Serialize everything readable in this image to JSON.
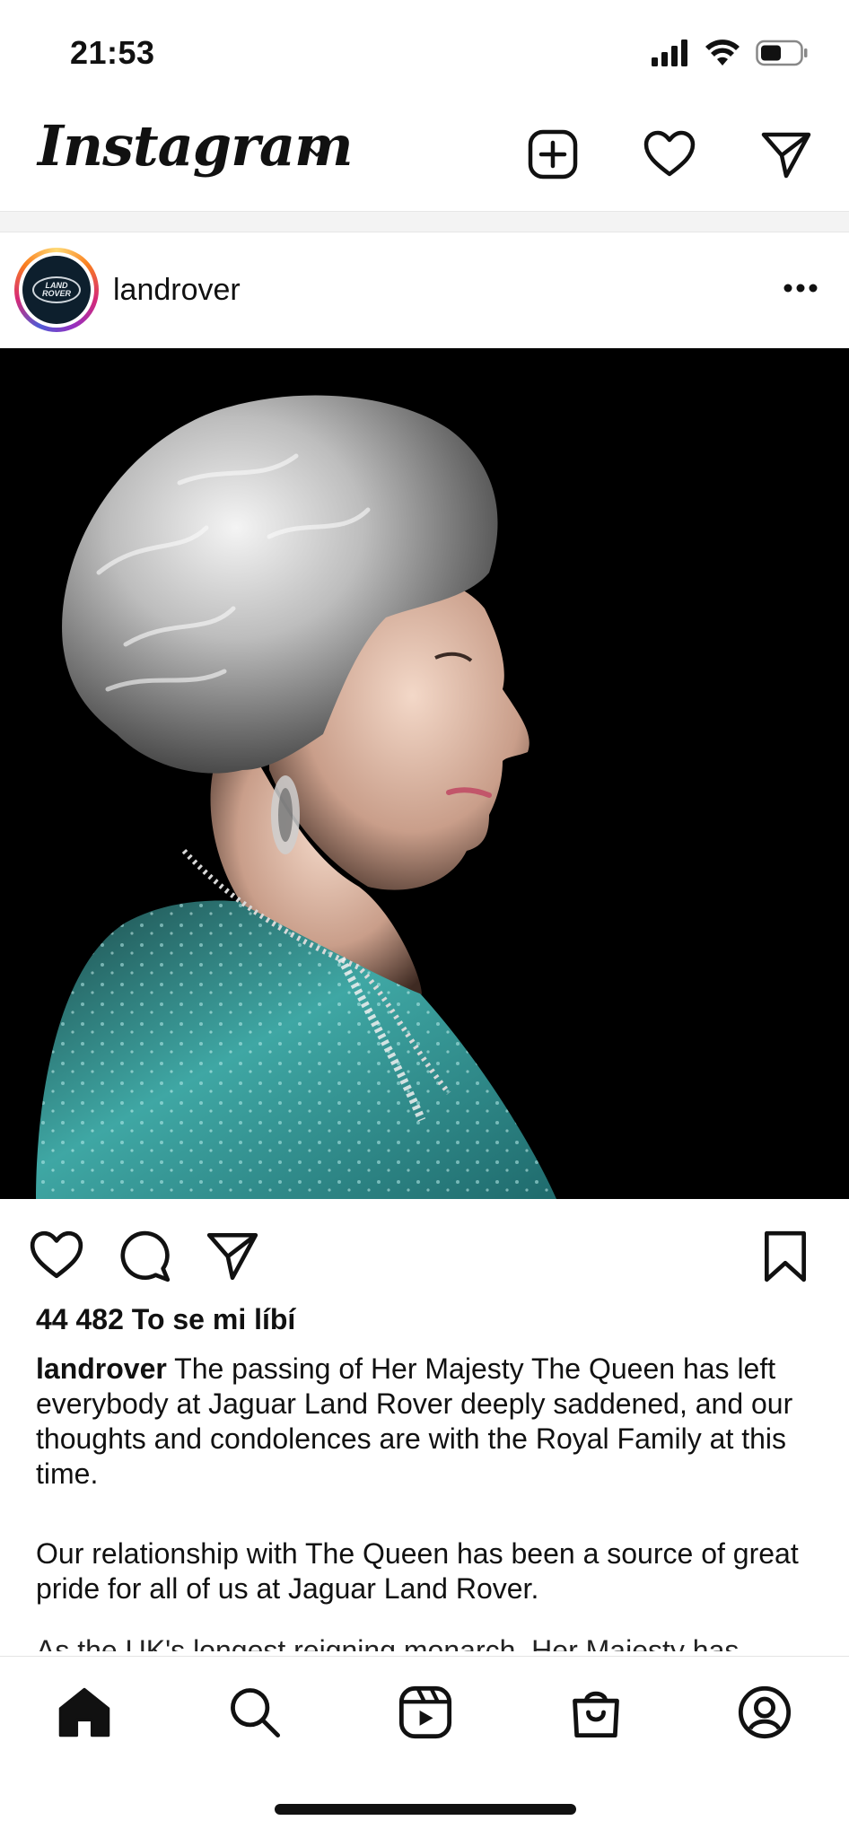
{
  "status_bar": {
    "time": "21:53",
    "icons": [
      "cellular-signal-icon",
      "wifi-icon",
      "battery-icon"
    ]
  },
  "header": {
    "logo": "Instagram",
    "icons": [
      "chevron-down-icon",
      "new-post-icon",
      "activity-heart-icon",
      "direct-messages-icon"
    ]
  },
  "post": {
    "username": "landrover",
    "avatar_text": "LAND ROVER",
    "image_description": "Portrait of Queen Elizabeth II in profile against black background",
    "likes": "44 482 To se mi líbí",
    "caption_username": "landrover",
    "caption_text": "The passing of Her Majesty The Queen has left everybody at Jaguar Land Rover deeply saddened, and our thoughts and condolences are with the Royal Family at this time.",
    "caption_p2": "Our relationship with The Queen has been a source of great pride for all of us at Jaguar Land Rover.",
    "caption_cut": "As the UK's longest reigning monarch, Her Majesty has"
  },
  "actions": [
    "like-icon",
    "comment-icon",
    "share-icon",
    "save-icon"
  ],
  "tab_bar": [
    "home-icon",
    "search-icon",
    "reels-icon",
    "shop-icon",
    "profile-icon"
  ],
  "colors": {
    "text": "#111111",
    "background": "#ffffff",
    "ring_gradient": [
      "#feda75",
      "#fa7e1e",
      "#d62976",
      "#962fbf",
      "#4f5bd5"
    ]
  }
}
